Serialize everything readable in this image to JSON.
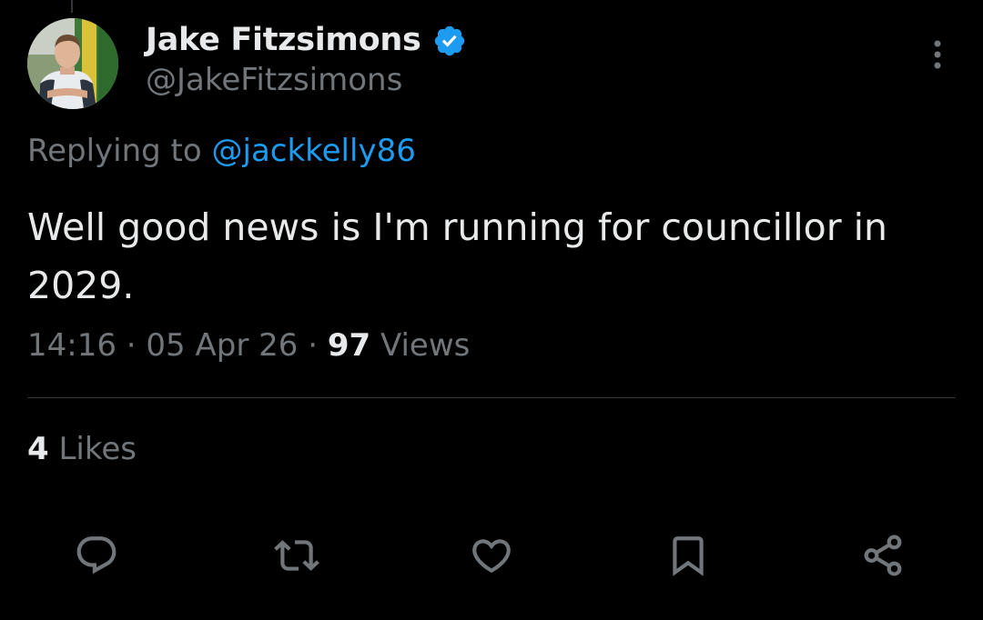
{
  "author": {
    "display_name": "Jake Fitzsimons",
    "handle": "@JakeFitzsimons",
    "verified": true
  },
  "reply": {
    "prefix": "Replying to",
    "mention": "@jackkelly86"
  },
  "tweet": {
    "text": "Well good news is I'm running for councillor in 2029."
  },
  "meta": {
    "time": "14:16",
    "date": "05 Apr 26",
    "views_count": "97",
    "views_label": "Views",
    "separator": "·"
  },
  "stats": {
    "likes_count": "4",
    "likes_label": "Likes"
  },
  "actions": [
    {
      "icon": "reply-icon"
    },
    {
      "icon": "retweet-icon"
    },
    {
      "icon": "like-icon"
    },
    {
      "icon": "bookmark-icon"
    },
    {
      "icon": "share-icon"
    }
  ],
  "colors": {
    "background": "#000000",
    "primary_text": "#e7e9ea",
    "secondary_text": "#71767b",
    "accent": "#1d9bf0",
    "divider": "#2f3336"
  }
}
